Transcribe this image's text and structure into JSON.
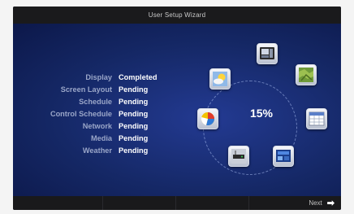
{
  "window": {
    "title": "User Setup Wizard"
  },
  "progress": {
    "percent_label": "15%",
    "fraction": 0.15
  },
  "status_items": [
    {
      "label": "Display",
      "status": "Completed"
    },
    {
      "label": "Screen Layout",
      "status": "Pending"
    },
    {
      "label": "Schedule",
      "status": "Pending"
    },
    {
      "label": "Control Schedule",
      "status": "Pending"
    },
    {
      "label": "Network",
      "status": "Pending"
    },
    {
      "label": "Media",
      "status": "Pending"
    },
    {
      "label": "Weather",
      "status": "Pending"
    }
  ],
  "wheel_icons": [
    "screen-layout-icon",
    "map-icon",
    "calendar-icon",
    "control-panel-icon",
    "network-icon",
    "pie-chart-icon",
    "weather-icon"
  ],
  "footer": {
    "next_label": "Next",
    "next_icon": "arrow-right-icon"
  },
  "colors": {
    "screen_bg": "#152866",
    "title_bar": "#1a1a1c",
    "completed": "#ffffff",
    "label": "#9aa6c8"
  }
}
